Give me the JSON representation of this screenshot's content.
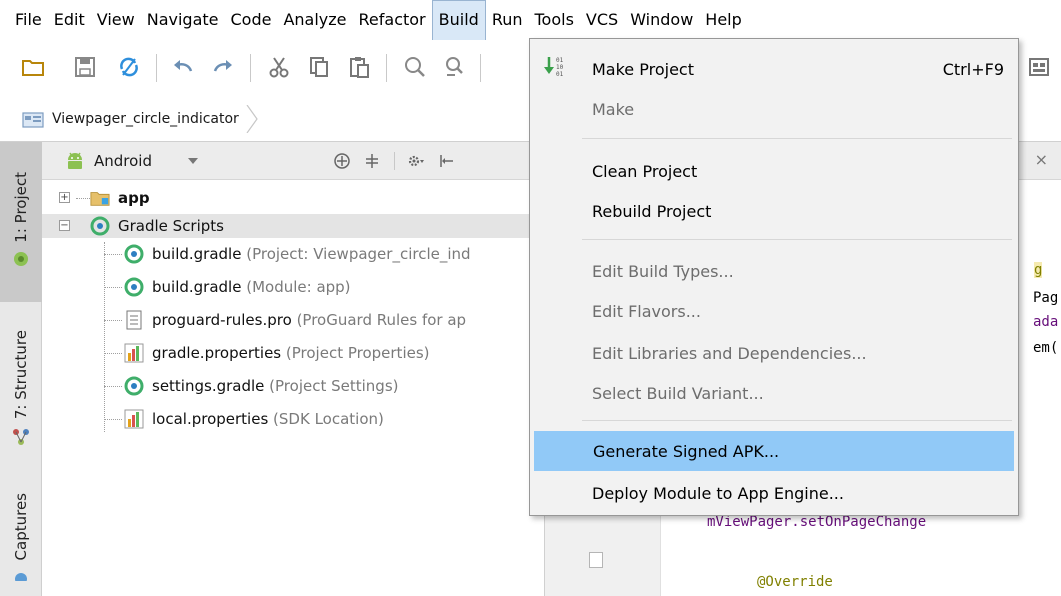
{
  "menubar": {
    "items": [
      "File",
      "Edit",
      "View",
      "Navigate",
      "Code",
      "Analyze",
      "Refactor",
      "Build",
      "Run",
      "Tools",
      "VCS",
      "Window",
      "Help"
    ],
    "active": "Build"
  },
  "toolbar": {
    "icons": [
      "open-folder-icon",
      "save-icon",
      "sync-icon",
      "undo-icon",
      "redo-icon",
      "cut-icon",
      "copy-icon",
      "paste-icon",
      "find-icon",
      "replace-icon"
    ]
  },
  "breadcrumb": {
    "project": "Viewpager_circle_indicator"
  },
  "sidestrip": {
    "project_tab": "1: Project",
    "structure_tab": "7: Structure",
    "captures_tab": "Captures"
  },
  "project_panel": {
    "view_mode": "Android",
    "tree": [
      {
        "name": "app",
        "hint": "",
        "level": 0,
        "expanded": false,
        "icon": "module-folder-icon"
      },
      {
        "name": "Gradle Scripts",
        "hint": "",
        "level": 0,
        "expanded": true,
        "icon": "gradle-icon"
      },
      {
        "name": "build.gradle",
        "hint": "(Project: Viewpager_circle_ind",
        "level": 1,
        "icon": "gradle-icon"
      },
      {
        "name": "build.gradle",
        "hint": "(Module: app)",
        "level": 1,
        "icon": "gradle-icon"
      },
      {
        "name": "proguard-rules.pro",
        "hint": "(ProGuard Rules for ap",
        "level": 1,
        "icon": "text-file-icon"
      },
      {
        "name": "gradle.properties",
        "hint": "(Project Properties)",
        "level": 1,
        "icon": "properties-icon"
      },
      {
        "name": "settings.gradle",
        "hint": "(Project Settings)",
        "level": 1,
        "icon": "gradle-icon"
      },
      {
        "name": "local.properties",
        "hint": "(SDK Location)",
        "level": 1,
        "icon": "properties-icon"
      }
    ]
  },
  "build_menu": {
    "items": [
      {
        "label": "Make Project",
        "shortcut": "Ctrl+F9",
        "enabled": true
      },
      {
        "label": "Make",
        "shortcut": "",
        "enabled": false
      },
      {
        "label": "Clean Project",
        "shortcut": "",
        "enabled": true
      },
      {
        "label": "Rebuild Project",
        "shortcut": "",
        "enabled": true
      },
      {
        "label": "Edit Build Types...",
        "shortcut": "",
        "enabled": false
      },
      {
        "label": "Edit Flavors...",
        "shortcut": "",
        "enabled": false
      },
      {
        "label": "Edit Libraries and Dependencies...",
        "shortcut": "",
        "enabled": false
      },
      {
        "label": "Select Build Variant...",
        "shortcut": "",
        "enabled": false
      },
      {
        "label": "Generate Signed APK...",
        "shortcut": "",
        "enabled": true,
        "highlighted": true
      },
      {
        "label": "Deploy Module to App Engine...",
        "shortcut": "",
        "enabled": true
      }
    ]
  },
  "editor": {
    "fragments": [
      "g",
      "Pag",
      "ada",
      "em(",
      "mViewPager.setOnPageChange",
      "@Override"
    ]
  },
  "colors": {
    "menu_highlight": "#91c9f7",
    "active_menu_bg": "#d9e8f7",
    "selected_row": "#e4e4e4"
  }
}
